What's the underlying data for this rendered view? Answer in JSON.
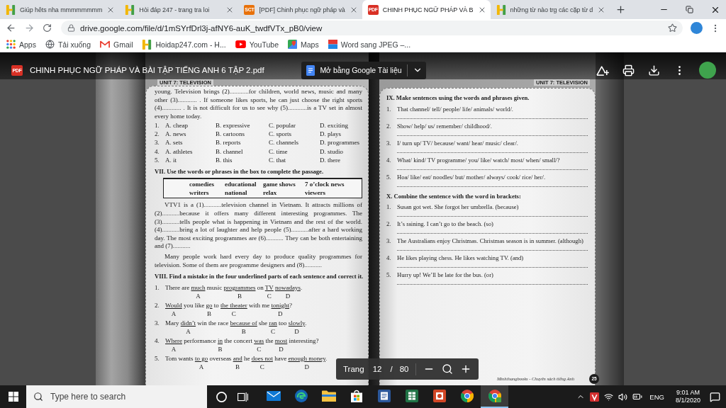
{
  "tabs": [
    {
      "title": "Giúp hêts nha mmmmmmmm",
      "kind": "logo",
      "selected": false
    },
    {
      "title": "Hỏi đáp 247 - trang tra loi",
      "kind": "logo",
      "selected": false
    },
    {
      "title": "[PDF] Chinh phục ngữ pháp và",
      "kind": "tag",
      "favicon_text": "SCT",
      "color": "#e8710a",
      "selected": false
    },
    {
      "title": "CHINH PHỤC NGỮ PHÁP VÀ B",
      "kind": "tag",
      "favicon_text": "PDF",
      "color": "#d93025",
      "selected": true
    },
    {
      "title": "những từ nào trg các cặp từ d",
      "kind": "logo",
      "selected": false
    }
  ],
  "address_bar": {
    "url": "drive.google.com/file/d/1mSYrfDrl3j-afNY6-auK_twdfVTx_pB0/view"
  },
  "bookmarks": [
    {
      "label": "Apps",
      "kind": "apps"
    },
    {
      "label": "Tải xuống",
      "kind": "globe"
    },
    {
      "label": "Gmail",
      "kind": "mail"
    },
    {
      "label": "Hoidap247.com - H...",
      "kind": "logo"
    },
    {
      "label": "YouTube",
      "kind": "play"
    },
    {
      "label": "Maps",
      "kind": "map"
    },
    {
      "label": "Word sang JPEG –...",
      "kind": "tile"
    }
  ],
  "viewer": {
    "file_tag": "PDF",
    "title": "CHINH PHỤC NGỮ PHÁP VÀ BÀI TẬP TIẾNG ANH 6 TẬP 2.pdf",
    "open_with": "Mở bằng Google Tài liệu",
    "pager": {
      "label": "Trang",
      "page": "12",
      "separator": "/",
      "total": "80"
    }
  },
  "document": {
    "left_page": {
      "header": "UNIT 7: TELEVISION",
      "passage": "young. Television brings (2)............for children, world news, music and many other (3)............ . If someone likes sports, he can just choose the right sports (4)............ . It is not difficult for us to see why (5)............is a TV set in almost every home today.",
      "choices": [
        {
          "number": "1.",
          "options": [
            "A. cheap",
            "B. expressive",
            "C. popular",
            "D. exciting"
          ]
        },
        {
          "number": "2.",
          "options": [
            "A. news",
            "B. cartoons",
            "C. sports",
            "D. plays"
          ]
        },
        {
          "number": "3.",
          "options": [
            "A. sets",
            "B. reports",
            "C. channels",
            "D. programmes"
          ]
        },
        {
          "number": "4.",
          "options": [
            "A. athletes",
            "B. channel",
            "C. time",
            "D. studio"
          ]
        },
        {
          "number": "5.",
          "options": [
            "A. it",
            "B. this",
            "C. that",
            "D. there"
          ]
        }
      ],
      "section_vii": {
        "heading": "VII. Use the words or phrases in the box to complete the passage.",
        "word_box": [
          "comedies",
          "educational",
          "game shows",
          "7 o’clock news",
          "writers",
          "national",
          "relax",
          "viewers"
        ],
        "paragraphs": [
          "VTV1 is a (1)...........television channel in Vietnam. It attracts millions of (2)...........because it offers many different interesting programmes. The (3)...........tells people what is happening in Vietnam and the rest of the world. (4)...........bring a lot of laughter and help people (5)...........after a hard working day. The most exciting programmes are (6)........... They can be both entertaining and (7)...........",
          "Many people work hard every day to produce quality programmes for television. Some of them are programme designers and (8)..........."
        ]
      },
      "section_viii": {
        "heading": "VIII. Find a mistake in the four underlined parts of each sentence and correct it.",
        "items": [
          {
            "number": "1.",
            "parts": [
              {
                "text": "There are ",
                "underlined": false
              },
              {
                "text": "much",
                "underlined": true,
                "letter": "A"
              },
              {
                "text": " music ",
                "underlined": false
              },
              {
                "text": "programmes",
                "underlined": true,
                "letter": "B"
              },
              {
                "text": " on ",
                "underlined": false
              },
              {
                "text": "TV",
                "underlined": true,
                "letter": "C"
              },
              {
                "text": " nowadays",
                "underlined": true,
                "letter": "D"
              },
              {
                "text": ".",
                "underlined": false
              }
            ]
          },
          {
            "number": "2.",
            "parts": [
              {
                "text": "Would",
                "underlined": true,
                "letter": "A"
              },
              {
                "text": " you like ",
                "underlined": false
              },
              {
                "text": "go",
                "underlined": true,
                "letter": "B"
              },
              {
                "text": " to ",
                "underlined": false
              },
              {
                "text": "the theater",
                "underlined": true,
                "letter": "C"
              },
              {
                "text": " with me ",
                "underlined": false
              },
              {
                "text": "tonight",
                "underlined": true,
                "letter": "D"
              },
              {
                "text": "?",
                "underlined": false
              }
            ]
          },
          {
            "number": "3.",
            "parts": [
              {
                "text": "Mary ",
                "underlined": false
              },
              {
                "text": "didn’t",
                "underlined": true,
                "letter": "A"
              },
              {
                "text": " win the race ",
                "underlined": false
              },
              {
                "text": "because of",
                "underlined": true,
                "letter": "B"
              },
              {
                "text": " she ",
                "underlined": false
              },
              {
                "text": "ran",
                "underlined": true,
                "letter": "C"
              },
              {
                "text": " too ",
                "underlined": false
              },
              {
                "text": "slowly",
                "underlined": true,
                "letter": "D"
              },
              {
                "text": ".",
                "underlined": false
              }
            ]
          },
          {
            "number": "4.",
            "parts": [
              {
                "text": "Where",
                "underlined": true,
                "letter": "A"
              },
              {
                "text": " performance ",
                "underlined": false
              },
              {
                "text": "in",
                "underlined": true,
                "letter": "B"
              },
              {
                "text": " the concert ",
                "underlined": false
              },
              {
                "text": "was",
                "underlined": true,
                "letter": "C"
              },
              {
                "text": " the ",
                "underlined": false
              },
              {
                "text": "most",
                "underlined": true,
                "letter": "D"
              },
              {
                "text": " interesting?",
                "underlined": false
              }
            ]
          },
          {
            "number": "5.",
            "parts": [
              {
                "text": "Tom wants ",
                "underlined": false
              },
              {
                "text": "to go",
                "underlined": true,
                "letter": "A"
              },
              {
                "text": " overseas ",
                "underlined": false
              },
              {
                "text": "and",
                "underlined": true,
                "letter": "B"
              },
              {
                "text": " he ",
                "underlined": false
              },
              {
                "text": "does not",
                "underlined": true,
                "letter": "C"
              },
              {
                "text": " have ",
                "underlined": false
              },
              {
                "text": "enough money",
                "underlined": true,
                "letter": "D"
              },
              {
                "text": ".",
                "underlined": false
              }
            ]
          }
        ]
      }
    },
    "right_page": {
      "header": "UNIT 7: TELEVISION",
      "sections": [
        {
          "heading": "IX. Make sentences using the words and phrases given.",
          "items": [
            {
              "number": "1.",
              "text": "That channel/ tell/ people/ life/ animals/ world/."
            },
            {
              "number": "2.",
              "text": "Show/ help/ us/ remember/ childhood/."
            },
            {
              "number": "3.",
              "text": "I/ turn up/ TV/ because/ want/ hear/ music/ clear/."
            },
            {
              "number": "4.",
              "text": "What/ kind/ TV programme/ you/ like/ watch/ most/ when/ small/?"
            },
            {
              "number": "5.",
              "text": "Hoa/ like/ eat/ noodles/ but/ mother/ always/ cook/ rice/ her/."
            }
          ]
        },
        {
          "heading": "X. Combine the sentence with the word in brackets:",
          "items": [
            {
              "number": "1.",
              "text": "Susan got wet. She forgot her umbrella. (because)"
            },
            {
              "number": "2.",
              "text": "It’s raining. I can’t go to the beach. (so)"
            },
            {
              "number": "3.",
              "text": "The Australians enjoy Christmas. Christmas season is in summer. (although)"
            },
            {
              "number": "4.",
              "text": "He likes playing chess. He likes watching TV. (and)"
            },
            {
              "number": "5.",
              "text": "Hurry up! We’ll be late for the bus. (or)"
            }
          ]
        }
      ],
      "footer": {
        "publisher": "Minhthangbooks - Chuyên sách tiếng Anh",
        "page_number": "25"
      }
    }
  },
  "taskbar": {
    "search": {
      "placeholder": "Type here to search"
    },
    "apps": [
      {
        "kind": "mail",
        "selected": false
      },
      {
        "kind": "swirl",
        "selected": false
      },
      {
        "kind": "folder",
        "selected": false
      },
      {
        "kind": "bag",
        "selected": false
      },
      {
        "kind": "doc",
        "selected": false
      },
      {
        "kind": "sheet",
        "selected": false
      },
      {
        "kind": "slides",
        "selected": false
      },
      {
        "kind": "ball",
        "selected": false
      },
      {
        "kind": "ball-badge",
        "selected": true
      }
    ],
    "language": "ENG",
    "time": "9:01 AM",
    "date": "8/1/2020"
  }
}
